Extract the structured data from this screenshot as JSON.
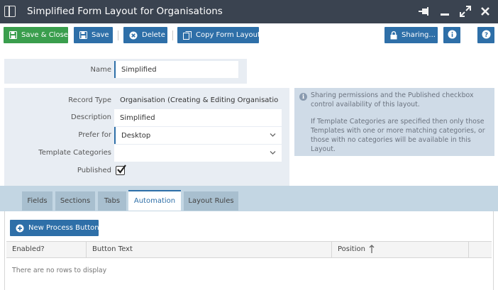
{
  "window": {
    "title": "Simplified Form Layout for Organisations"
  },
  "toolbar": {
    "save_close": "Save & Close",
    "save": "Save",
    "delete": "Delete",
    "copy_form_layout": "Copy Form Layout",
    "sharing": "Sharing..."
  },
  "form": {
    "name_label": "Name",
    "name_value": "Simplified",
    "record_type_label": "Record Type",
    "record_type_value": "Organisation (Creating & Editing Organisation",
    "description_label": "Description",
    "description_value": "Simplified",
    "prefer_for_label": "Prefer for",
    "prefer_for_value": "Desktop",
    "template_categories_label": "Template Categories",
    "template_categories_value": "",
    "published_label": "Published",
    "published_checked": true
  },
  "info": {
    "line1": "Sharing permissions and the Published checkbox",
    "line2": "control availability of this layout.",
    "line3": "If Template Categories are specified then only those",
    "line4": "Templates with one or more matching categories, or",
    "line5": "those with no categories will be available in this",
    "line6": "Layout."
  },
  "tabs": [
    {
      "label": "Fields"
    },
    {
      "label": "Sections"
    },
    {
      "label": "Tabs"
    },
    {
      "label": "Automation",
      "active": true
    },
    {
      "label": "Layout Rules"
    }
  ],
  "automation": {
    "new_button": "New Process Button",
    "columns": [
      "Enabled?",
      "Button Text",
      "Position"
    ],
    "empty_text": "There are no rows to display"
  },
  "colors": {
    "titlebar": "#3a4350",
    "accent_blue": "#2e6fa8",
    "save_green": "#3a9e4d",
    "panel": "#e8edf3",
    "info_panel": "#cfdbe7",
    "tabs_bar": "#c3d6e3"
  }
}
